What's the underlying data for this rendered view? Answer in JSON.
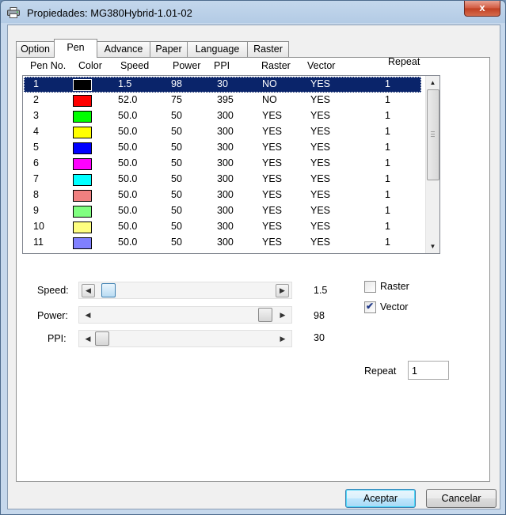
{
  "window": {
    "title": "Propiedades: MG380Hybrid-1.01-02",
    "close_glyph": "x"
  },
  "tabs": [
    "Option",
    "Pen",
    "Advance",
    "Paper",
    "Language",
    "Raster"
  ],
  "active_tab": "Pen",
  "pen_list": {
    "columns": [
      "Pen No.",
      "Color",
      "Speed",
      "Power",
      "PPI",
      "Raster",
      "Vector",
      "Repeat"
    ],
    "rows": [
      {
        "no": "1",
        "color": "#000000",
        "speed": "1.5",
        "power": "98",
        "ppi": "30",
        "raster": "NO",
        "vector": "YES",
        "repeat": "1"
      },
      {
        "no": "2",
        "color": "#ff0000",
        "speed": "52.0",
        "power": "75",
        "ppi": "395",
        "raster": "NO",
        "vector": "YES",
        "repeat": "1"
      },
      {
        "no": "3",
        "color": "#00ff00",
        "speed": "50.0",
        "power": "50",
        "ppi": "300",
        "raster": "YES",
        "vector": "YES",
        "repeat": "1"
      },
      {
        "no": "4",
        "color": "#ffff00",
        "speed": "50.0",
        "power": "50",
        "ppi": "300",
        "raster": "YES",
        "vector": "YES",
        "repeat": "1"
      },
      {
        "no": "5",
        "color": "#0000ff",
        "speed": "50.0",
        "power": "50",
        "ppi": "300",
        "raster": "YES",
        "vector": "YES",
        "repeat": "1"
      },
      {
        "no": "6",
        "color": "#ff00ff",
        "speed": "50.0",
        "power": "50",
        "ppi": "300",
        "raster": "YES",
        "vector": "YES",
        "repeat": "1"
      },
      {
        "no": "7",
        "color": "#00ffff",
        "speed": "50.0",
        "power": "50",
        "ppi": "300",
        "raster": "YES",
        "vector": "YES",
        "repeat": "1"
      },
      {
        "no": "8",
        "color": "#f08080",
        "speed": "50.0",
        "power": "50",
        "ppi": "300",
        "raster": "YES",
        "vector": "YES",
        "repeat": "1"
      },
      {
        "no": "9",
        "color": "#80ff80",
        "speed": "50.0",
        "power": "50",
        "ppi": "300",
        "raster": "YES",
        "vector": "YES",
        "repeat": "1"
      },
      {
        "no": "10",
        "color": "#ffff80",
        "speed": "50.0",
        "power": "50",
        "ppi": "300",
        "raster": "YES",
        "vector": "YES",
        "repeat": "1"
      },
      {
        "no": "11",
        "color": "#8080ff",
        "speed": "50.0",
        "power": "50",
        "ppi": "300",
        "raster": "YES",
        "vector": "YES",
        "repeat": "1"
      }
    ],
    "selected_index": 0
  },
  "sliders": {
    "speed": {
      "label": "Speed:",
      "value": "1.5",
      "level": 0.04
    },
    "power": {
      "label": "Power:",
      "value": "98",
      "level": 0.98
    },
    "ppi": {
      "label": "PPI:",
      "value": "30",
      "level": 0.0
    }
  },
  "options": {
    "raster": {
      "label": "Raster",
      "checked": false
    },
    "vector": {
      "label": "Vector",
      "checked": true
    },
    "repeat_label": "Repeat",
    "repeat_value": "1"
  },
  "buttons": {
    "ok": "Aceptar",
    "cancel": "Cancelar"
  },
  "icons": {
    "title": "printer-icon",
    "check": "checkmark-icon"
  },
  "colors": {
    "selection": "#0a246a",
    "title_bar": "#b3cbe5",
    "close_button": "#c9482c"
  }
}
